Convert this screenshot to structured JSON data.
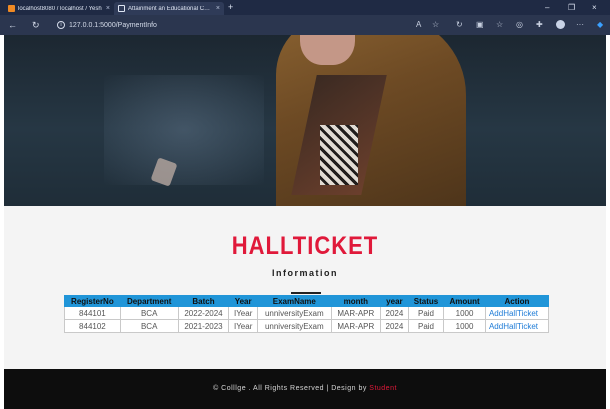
{
  "browser": {
    "tabs": [
      {
        "title": "localhost8080 / localhost / Yesh",
        "close": "×",
        "favicon_color": "#f08a24"
      },
      {
        "title": "Attainment an Educational Categ",
        "close": "×",
        "favicon_color": "#ffffff"
      }
    ],
    "new_tab": "+",
    "url": "127.0.0.1:5000/PaymentInfo",
    "window": {
      "minimize": "–",
      "maximize": "❐",
      "close": "×"
    }
  },
  "hero": {
    "description_color": "#263744"
  },
  "main": {
    "heading": "HALLTICKET",
    "subheading": "Information"
  },
  "table": {
    "headers": [
      "RegisterNo",
      "Department",
      "Batch",
      "Year",
      "ExamName",
      "month",
      "year",
      "Status",
      "Amount",
      "Action"
    ],
    "rows": [
      [
        "844101",
        "BCA",
        "2022-2024",
        "IYear",
        "unniversityExam",
        "MAR-APR",
        "2024",
        "Paid",
        "1000",
        "AddHallTicket"
      ],
      [
        "844102",
        "BCA",
        "2021-2023",
        "IYear",
        "unniversityExam",
        "MAR-APR",
        "2024",
        "Paid",
        "1000",
        "AddHallTicket"
      ]
    ]
  },
  "footer": {
    "text": "© Colllge . All Rights Reserved | Design by ",
    "brand": "Student"
  },
  "colors": {
    "accent": "#e0193a",
    "table_header": "#2095d8",
    "link": "#1e7bd6"
  }
}
